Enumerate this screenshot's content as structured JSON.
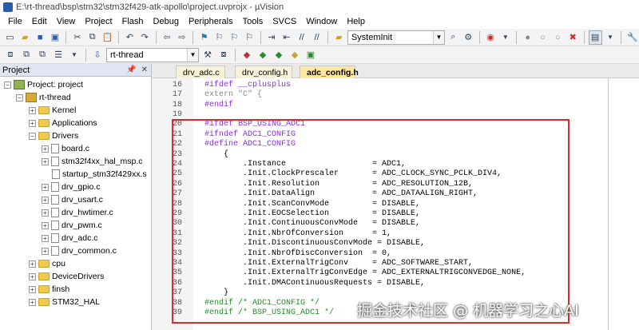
{
  "window": {
    "title": "E:\\rt-thread\\bsp\\stm32\\stm32f429-atk-apollo\\project.uvprojx - µVision"
  },
  "menu": [
    "File",
    "Edit",
    "View",
    "Project",
    "Flash",
    "Debug",
    "Peripherals",
    "Tools",
    "SVCS",
    "Window",
    "Help"
  ],
  "toolbar": {
    "function_combo": "SystemInit",
    "target_combo": "rt-thread"
  },
  "project_panel": {
    "title": "Project",
    "root": "Project: project",
    "target": "rt-thread",
    "groups": [
      "Kernel",
      "Applications",
      "Drivers"
    ],
    "driver_files": [
      "board.c",
      "stm32f4xx_hal_msp.c",
      "startup_stm32f429xx.s",
      "drv_gpio.c",
      "drv_usart.c",
      "drv_hwtimer.c",
      "drv_pwm.c",
      "drv_adc.c",
      "drv_common.c"
    ],
    "more_groups": [
      "cpu",
      "DeviceDrivers",
      "finsh",
      "STM32_HAL"
    ]
  },
  "editor": {
    "tabs": [
      "drv_adc.c",
      "drv_config.h",
      "adc_config.h"
    ],
    "active_tab": "adc_config.h",
    "lines": [
      {
        "n": "16",
        "text": "#ifdef __cplusplus"
      },
      {
        "n": "17",
        "text": "extern \"C\" {"
      },
      {
        "n": "18",
        "text": "#endif"
      },
      {
        "n": "19",
        "text": ""
      },
      {
        "n": "20",
        "text": "#ifdef BSP_USING_ADC1"
      },
      {
        "n": "21",
        "text": "#ifndef ADC1_CONFIG"
      },
      {
        "n": "22",
        "text": "#define ADC1_CONFIG"
      },
      {
        "n": "23",
        "text": "    {"
      },
      {
        "n": "24",
        "text": "        .Instance                  = ADC1,"
      },
      {
        "n": "25",
        "text": "        .Init.ClockPrescaler       = ADC_CLOCK_SYNC_PCLK_DIV4,"
      },
      {
        "n": "26",
        "text": "        .Init.Resolution           = ADC_RESOLUTION_12B,"
      },
      {
        "n": "27",
        "text": "        .Init.DataAlign            = ADC_DATAALIGN_RIGHT,"
      },
      {
        "n": "28",
        "text": "        .Init.ScanConvMode         = DISABLE,"
      },
      {
        "n": "29",
        "text": "        .Init.EOCSelection         = DISABLE,"
      },
      {
        "n": "30",
        "text": "        .Init.ContinuousConvMode   = DISABLE,"
      },
      {
        "n": "31",
        "text": "        .Init.NbrOfConversion      = 1,"
      },
      {
        "n": "32",
        "text": "        .Init.DiscontinuousConvMode = DISABLE,"
      },
      {
        "n": "33",
        "text": "        .Init.NbrOfDiscConversion  = 0,"
      },
      {
        "n": "34",
        "text": "        .Init.ExternalTrigConv     = ADC_SOFTWARE_START,"
      },
      {
        "n": "35",
        "text": "        .Init.ExternalTrigConvEdge = ADC_EXTERNALTRIGCONVEDGE_NONE,"
      },
      {
        "n": "36",
        "text": "        .Init.DMAContinuousRequests = DISABLE,"
      },
      {
        "n": "37",
        "text": "    }"
      },
      {
        "n": "38",
        "text": "#endif /* ADC1_CONFIG */"
      },
      {
        "n": "39",
        "text": "#endif /* BSP_USING_ADC1 */"
      }
    ]
  },
  "watermark": "掘金技术社区 @ 机器学习之心AI",
  "colors": {
    "highlight_border": "#e02a2a",
    "tab_active": "#ffe7a0"
  }
}
